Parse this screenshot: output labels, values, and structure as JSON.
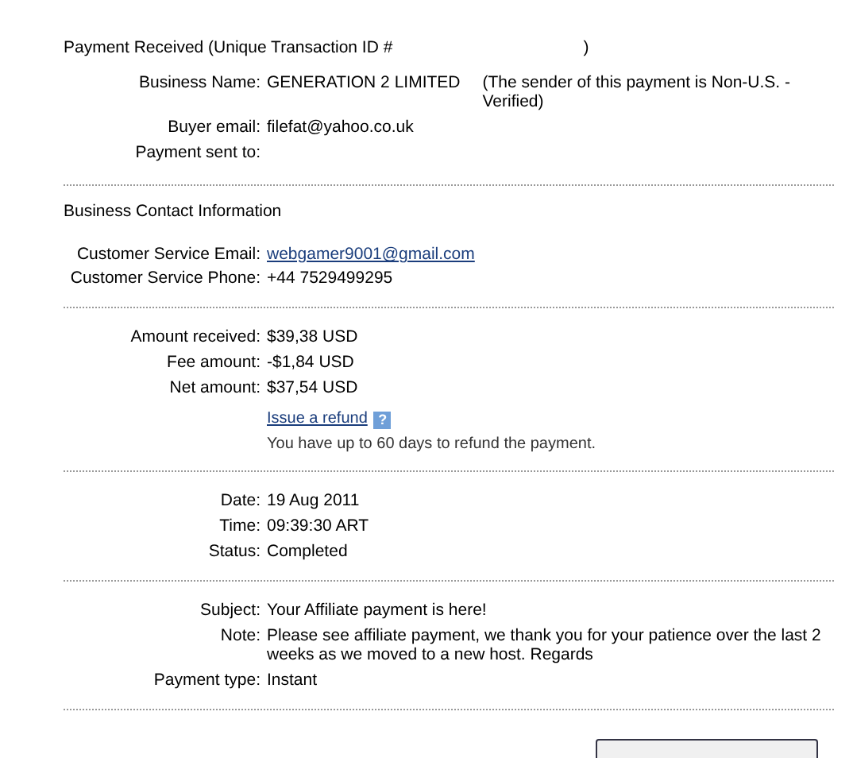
{
  "header": {
    "title": "Payment Received (Unique Transaction ID #",
    "close": ")"
  },
  "sections": [
    {
      "rows": [
        {
          "kind": "text",
          "label": "Business Name:",
          "value": "GENERATION 2 LIMITED",
          "extra": "(The sender of this payment is Non-U.S. - Verified)"
        },
        {
          "kind": "text",
          "label": "Buyer email:",
          "value": "filefat@yahoo.co.uk"
        },
        {
          "kind": "text",
          "label": "Payment sent to:"
        }
      ]
    },
    {
      "title": "Business Contact Information",
      "rows": [
        {
          "kind": "link",
          "label": "Customer Service Email:",
          "value": "webgamer9001@gmail.com"
        },
        {
          "kind": "text",
          "label": "Customer Service Phone:",
          "value": "+44 7529499295"
        }
      ]
    },
    {
      "rows": [
        {
          "kind": "text",
          "label": "Amount received:",
          "value": "$39,38 USD"
        },
        {
          "kind": "text",
          "label": "Fee amount:",
          "value": "-$1,84 USD"
        },
        {
          "kind": "text",
          "label": "Net amount:",
          "value": "$37,54 USD"
        },
        {
          "kind": "refund",
          "value": "Issue a refund",
          "help": "?",
          "note": "You have up to 60 days to refund the payment."
        }
      ]
    },
    {
      "rows": [
        {
          "kind": "text",
          "label": "Date:",
          "value": "19 Aug 2011"
        },
        {
          "kind": "text",
          "label": "Time:",
          "value": "09:39:30 ART"
        },
        {
          "kind": "text",
          "label": "Status:",
          "value": "Completed"
        }
      ]
    },
    {
      "rows": [
        {
          "kind": "text",
          "label": "Subject:",
          "value": "Your Affiliate payment is here!"
        },
        {
          "kind": "text",
          "label": "Note:",
          "value": "Please see affiliate payment, we thank you for your patience over the last 2 weeks as we moved to a new host. Regards"
        },
        {
          "kind": "text",
          "label": "Payment type:",
          "value": "Instant"
        }
      ]
    }
  ]
}
